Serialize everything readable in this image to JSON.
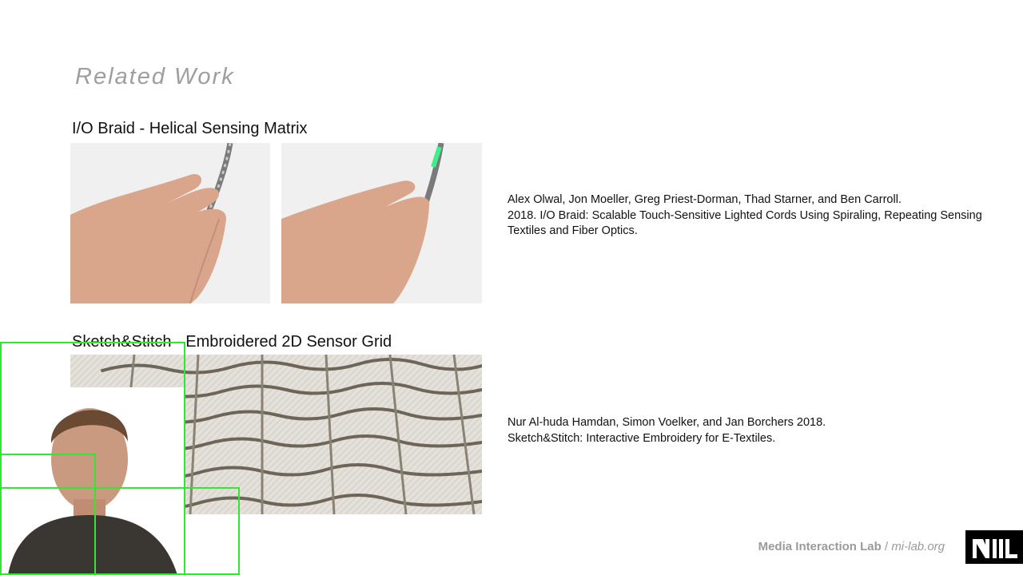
{
  "slide": {
    "title": "Related Work"
  },
  "sections": [
    {
      "heading": "I/O Braid - Helical Sensing Matrix",
      "citation": {
        "authors": "Alex Olwal, Jon Moeller, Greg Priest-Dorman, Thad Starner, and Ben Carroll.",
        "rest": "2018. I/O Braid: Scalable Touch-Sensitive Lighted Cords Using Spiraling, Repeating Sensing Textiles and Fiber Optics."
      }
    },
    {
      "heading": "Sketch&Stitch - Embroidered 2D Sensor Grid",
      "citation": {
        "authors": "Nur Al-huda Hamdan, Simon Voelker, and Jan Borchers 2018.",
        "rest": "Sketch&Stitch: Interactive Embroidery for E-Textiles."
      }
    }
  ],
  "footer": {
    "lab": "Media Interaction Lab",
    "separator": "/",
    "url": "mi-lab.org",
    "logo": "MIL"
  },
  "colors": {
    "title_gray": "#9e9e9e",
    "detection_green": "#33e633",
    "led_green": "#3df08a"
  },
  "icons": {
    "logo": "mil-logo-icon"
  }
}
